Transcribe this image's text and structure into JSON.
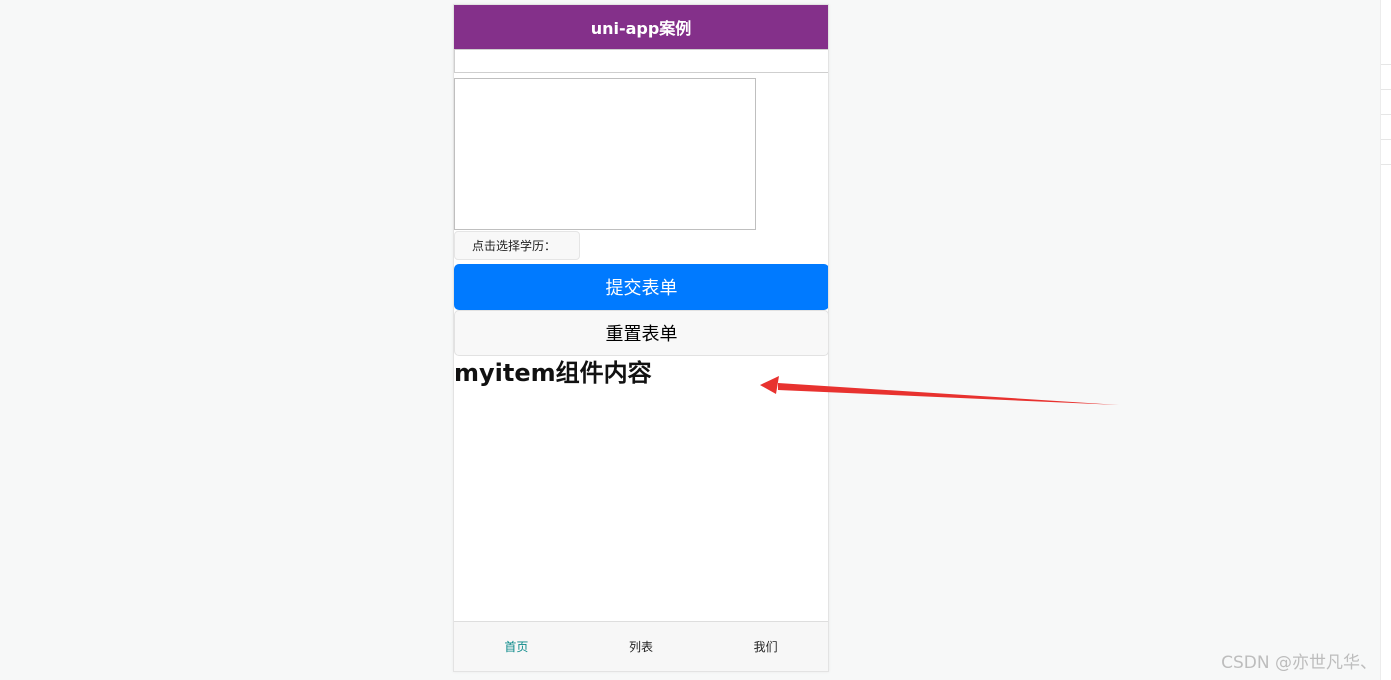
{
  "navbar": {
    "title": "uni-app案例",
    "background": "#84308a"
  },
  "form": {
    "input_value": "",
    "textarea_value": "",
    "picker_label": "点击选择学历：",
    "submit_label": "提交表单",
    "reset_label": "重置表单",
    "submit_color": "#007aff"
  },
  "component": {
    "text": "myitem组件内容"
  },
  "tabbar": {
    "items": [
      {
        "label": "首页",
        "active": true
      },
      {
        "label": "列表",
        "active": false
      },
      {
        "label": "我们",
        "active": false
      }
    ],
    "active_color": "#0b8a8a"
  },
  "annotation": {
    "arrow_color": "#e8322f"
  },
  "watermark": {
    "text": "CSDN @亦世凡华、"
  }
}
